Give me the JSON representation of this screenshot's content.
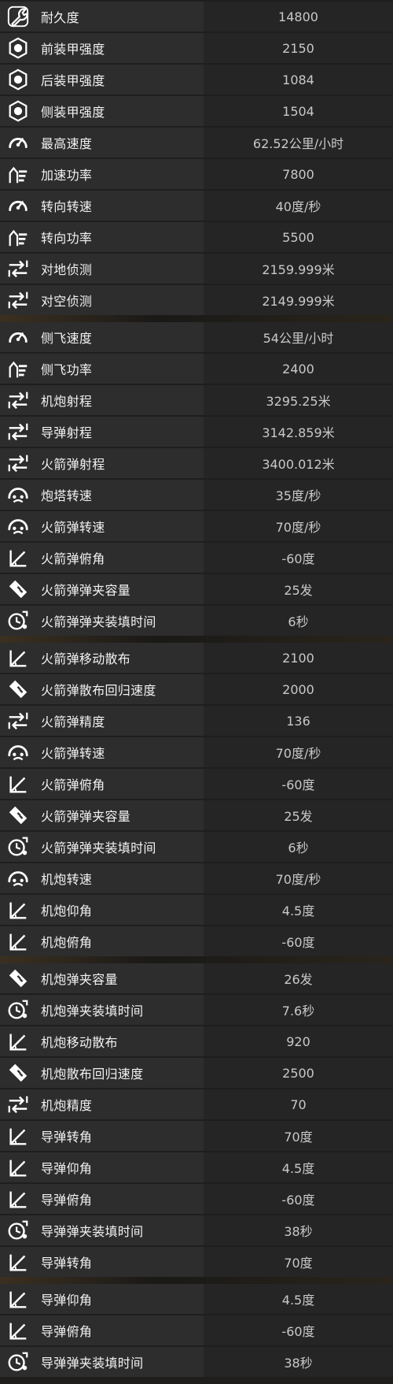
{
  "rows": [
    {
      "label": "耐久度",
      "value": "14800",
      "icon": "wrench-icon"
    },
    {
      "label": "前装甲强度",
      "value": "2150",
      "icon": "armor-icon"
    },
    {
      "label": "后装甲强度",
      "value": "1084",
      "icon": "armor-icon"
    },
    {
      "label": "侧装甲强度",
      "value": "1504",
      "icon": "armor-icon"
    },
    {
      "label": "最高速度",
      "value": "62.52公里/小时",
      "icon": "speedometer-icon"
    },
    {
      "label": "加速功率",
      "value": "7800",
      "icon": "power-arrows-icon"
    },
    {
      "label": "转向转速",
      "value": "40度/秒",
      "icon": "speedometer-icon"
    },
    {
      "label": "转向功率",
      "value": "5500",
      "icon": "power-arrows-icon"
    },
    {
      "label": "对地侦测",
      "value": "2159.999米",
      "icon": "range-icon"
    },
    {
      "label": "对空侦测",
      "value": "2149.999米",
      "icon": "range-icon"
    },
    {
      "label": "侧飞速度",
      "value": "54公里/小时",
      "icon": "speedometer-icon"
    },
    {
      "label": "侧飞功率",
      "value": "2400",
      "icon": "power-arrows-icon"
    },
    {
      "label": "机炮射程",
      "value": "3295.25米",
      "icon": "range-icon"
    },
    {
      "label": "导弹射程",
      "value": "3142.859米",
      "icon": "range-icon"
    },
    {
      "label": "火箭弹射程",
      "value": "3400.012米",
      "icon": "range-icon"
    },
    {
      "label": "炮塔转速",
      "value": "35度/秒",
      "icon": "turret-speed-icon"
    },
    {
      "label": "火箭弹转速",
      "value": "70度/秒",
      "icon": "turret-speed-icon"
    },
    {
      "label": "火箭弹俯角",
      "value": "-60度",
      "icon": "angle-icon"
    },
    {
      "label": "火箭弹弹夹容量",
      "value": "25发",
      "icon": "magazine-icon"
    },
    {
      "label": "火箭弹弹夹装填时间",
      "value": "6秒",
      "icon": "reload-timer-icon"
    },
    {
      "label": "火箭弹移动散布",
      "value": "2100",
      "icon": "angle-icon"
    },
    {
      "label": "火箭弹散布回归速度",
      "value": "2000",
      "icon": "magazine-icon"
    },
    {
      "label": "火箭弹精度",
      "value": "136",
      "icon": "range-icon"
    },
    {
      "label": "火箭弹转速",
      "value": "70度/秒",
      "icon": "turret-speed-icon"
    },
    {
      "label": "火箭弹俯角",
      "value": "-60度",
      "icon": "angle-icon"
    },
    {
      "label": "火箭弹弹夹容量",
      "value": "25发",
      "icon": "magazine-icon"
    },
    {
      "label": "火箭弹弹夹装填时间",
      "value": "6秒",
      "icon": "reload-timer-icon"
    },
    {
      "label": "机炮转速",
      "value": "70度/秒",
      "icon": "turret-speed-icon"
    },
    {
      "label": "机炮仰角",
      "value": "4.5度",
      "icon": "angle-icon"
    },
    {
      "label": "机炮俯角",
      "value": "-60度",
      "icon": "angle-icon"
    },
    {
      "label": "机炮弹夹容量",
      "value": "26发",
      "icon": "magazine-icon"
    },
    {
      "label": "机炮弹夹装填时间",
      "value": "7.6秒",
      "icon": "reload-timer-icon"
    },
    {
      "label": "机炮移动散布",
      "value": "920",
      "icon": "angle-icon"
    },
    {
      "label": "机炮散布回归速度",
      "value": "2500",
      "icon": "magazine-icon"
    },
    {
      "label": "机炮精度",
      "value": "70",
      "icon": "range-icon"
    },
    {
      "label": "导弹转角",
      "value": "70度",
      "icon": "angle-icon"
    },
    {
      "label": "导弹仰角",
      "value": "4.5度",
      "icon": "angle-icon"
    },
    {
      "label": "导弹俯角",
      "value": "-60度",
      "icon": "angle-icon"
    },
    {
      "label": "导弹弹夹装填时间",
      "value": "38秒",
      "icon": "reload-timer-icon"
    },
    {
      "label": "导弹转角",
      "value": "70度",
      "icon": "angle-icon"
    },
    {
      "label": "导弹仰角",
      "value": "4.5度",
      "icon": "angle-icon"
    },
    {
      "label": "导弹俯角",
      "value": "-60度",
      "icon": "angle-icon"
    },
    {
      "label": "导弹弹夹装填时间",
      "value": "38秒",
      "icon": "reload-timer-icon"
    }
  ]
}
